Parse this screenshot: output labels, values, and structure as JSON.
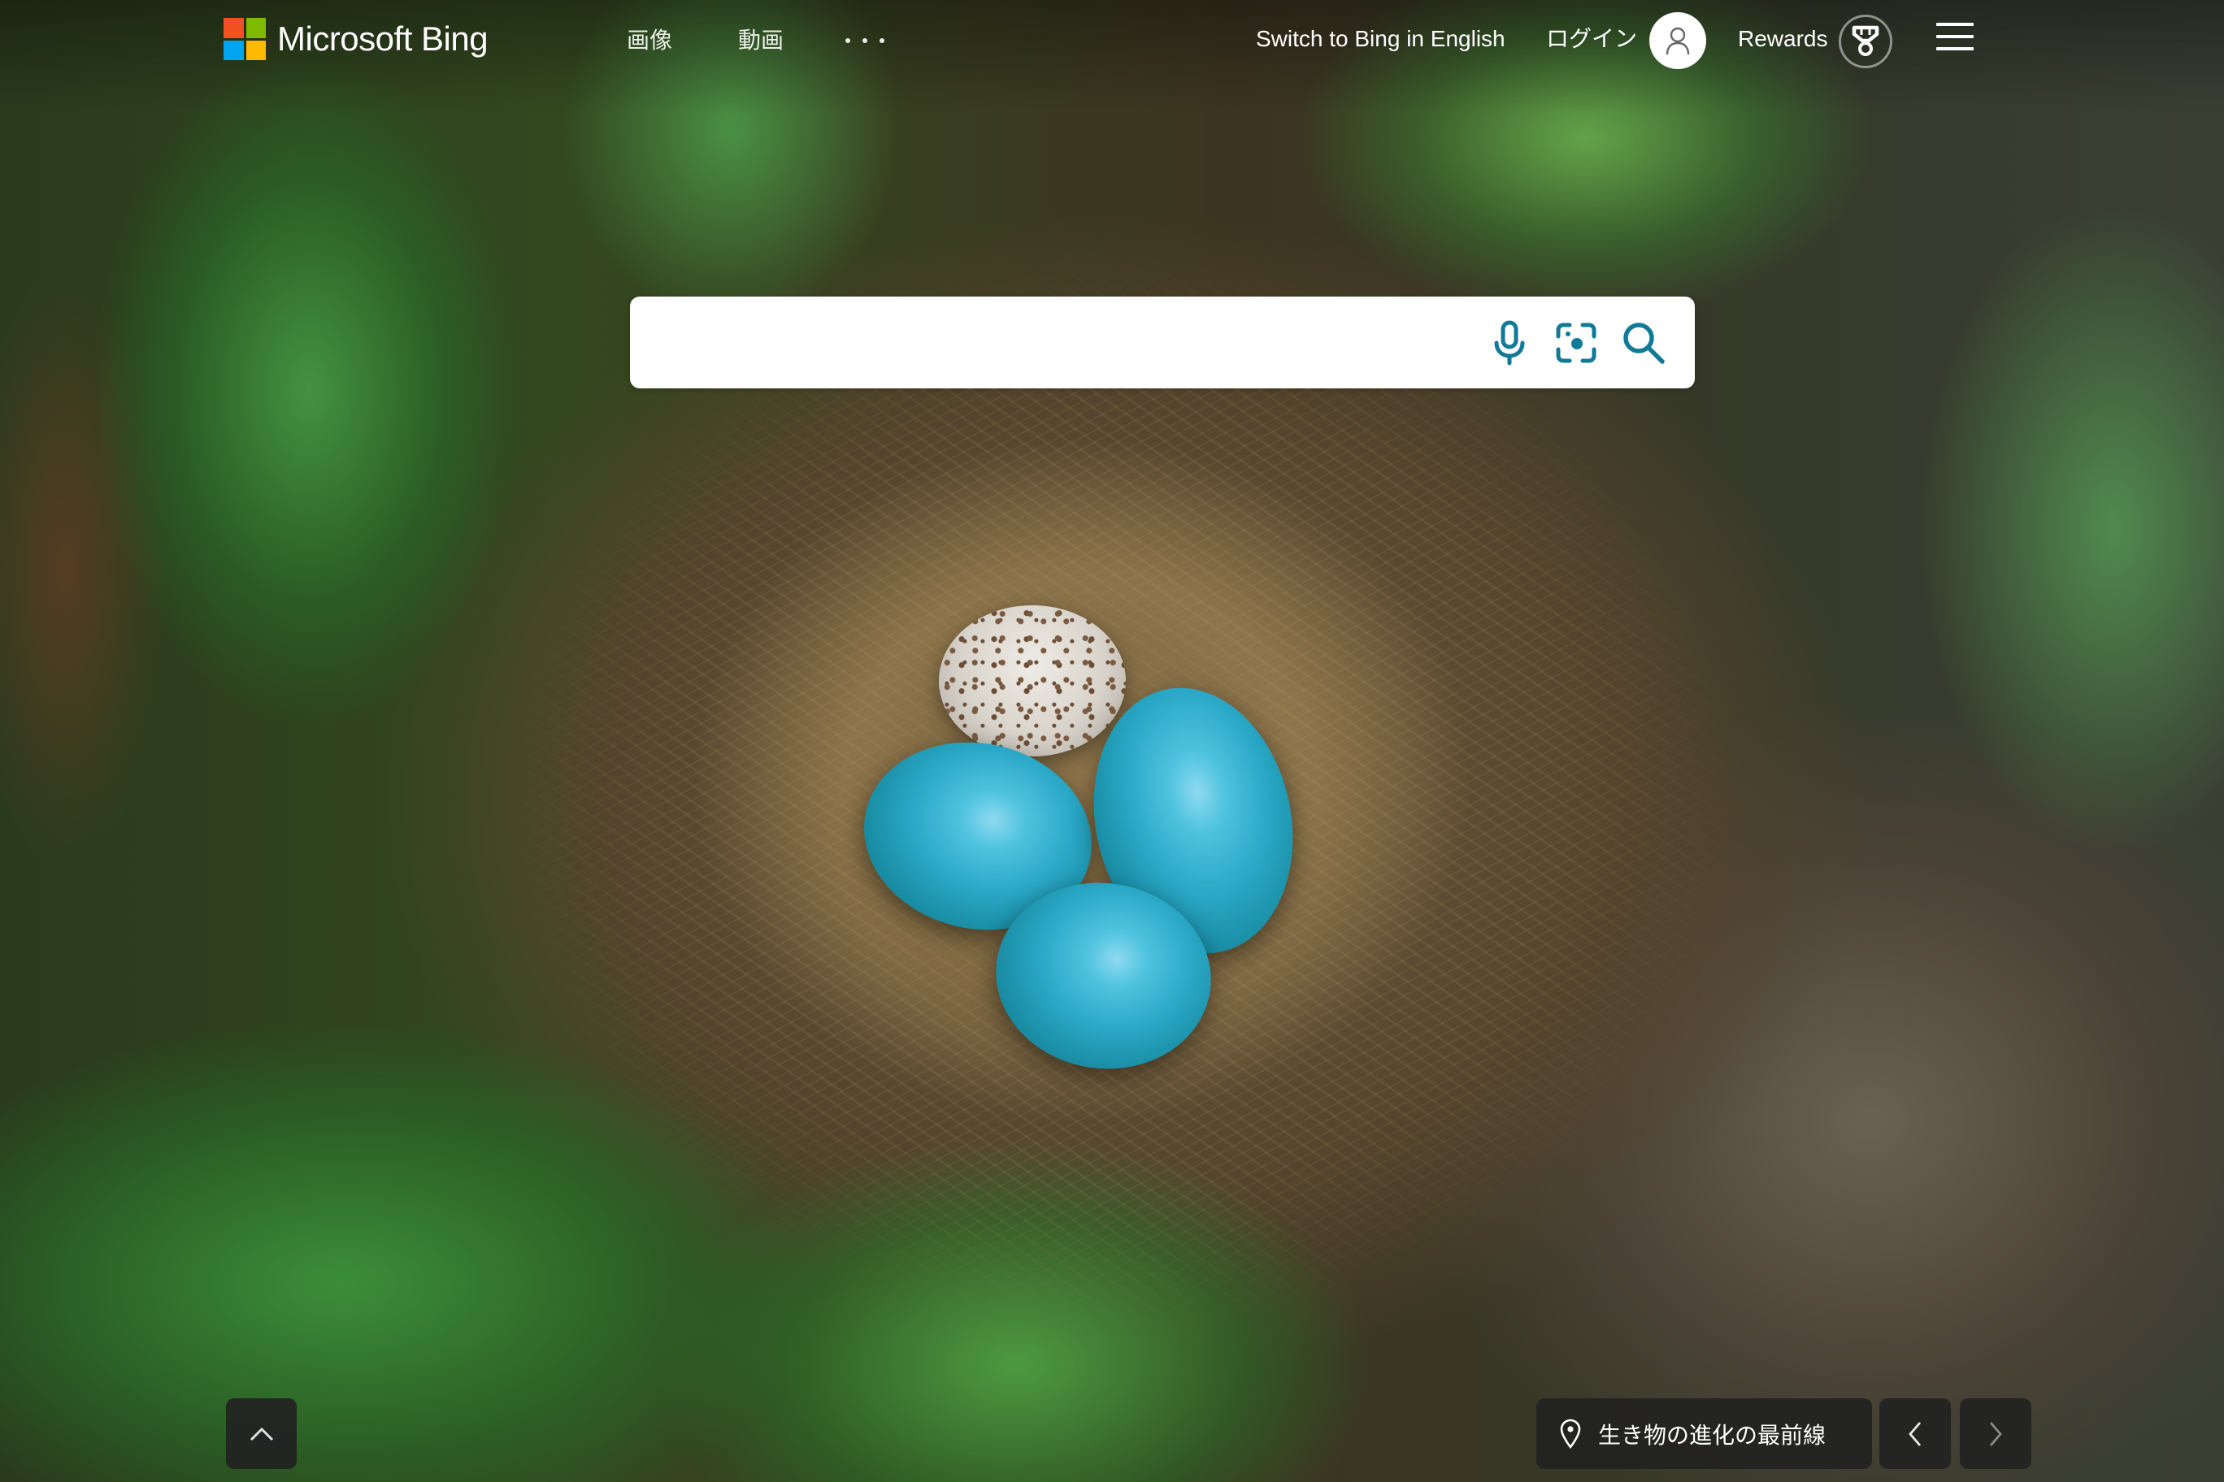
{
  "brand": {
    "name": "Microsoft Bing",
    "logo_colors": [
      "#f25022",
      "#7fba00",
      "#00a4ef",
      "#ffb900"
    ]
  },
  "nav": {
    "items": [
      {
        "label": "画像"
      },
      {
        "label": "動画"
      }
    ],
    "more_icon": "ellipsis-icon"
  },
  "header_right": {
    "switch_language": "Switch to Bing in English",
    "login": "ログイン",
    "avatar_icon": "user-icon",
    "rewards": "Rewards",
    "rewards_icon": "medal-icon",
    "menu_icon": "hamburger-icon"
  },
  "search": {
    "value": "",
    "placeholder": "",
    "icons": [
      "microphone-icon",
      "visual-search-icon",
      "search-icon"
    ],
    "accent_color": "#117a97"
  },
  "background": {
    "description": "Bird nest with three blue eggs and one speckled egg"
  },
  "footer": {
    "scroll_up_icon": "chevron-up-icon",
    "caption_icon": "location-pin-icon",
    "caption": "生き物の進化の最前線",
    "prev_icon": "chevron-left-icon",
    "next_icon": "chevron-right-icon"
  }
}
